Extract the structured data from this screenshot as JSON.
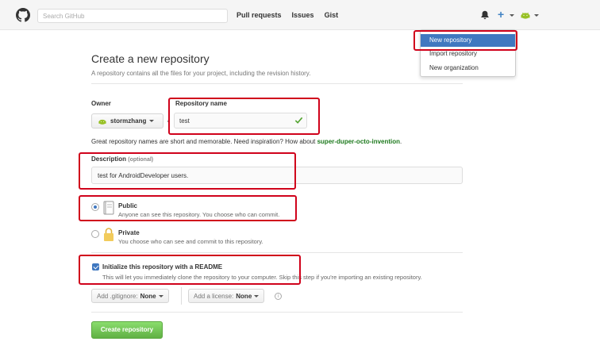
{
  "header": {
    "search_placeholder": "Search GitHub",
    "nav": [
      "Pull requests",
      "Issues",
      "Gist"
    ]
  },
  "dropdown": {
    "items": [
      "New repository",
      "Import repository",
      "New organization"
    ]
  },
  "page": {
    "title": "Create a new repository",
    "subtitle": "A repository contains all the files for your project, including the revision history."
  },
  "owner": {
    "label": "Owner",
    "value": "stormzhang"
  },
  "repo": {
    "label": "Repository name",
    "separator": "/",
    "value": "test"
  },
  "hint": {
    "text": "Great repository names are short and memorable. Need inspiration? How about ",
    "suggestion": "super-duper-octo-invention",
    "end": "."
  },
  "description": {
    "label": "Description",
    "optional": "(optional)",
    "value": "test for AndroidDeveloper users."
  },
  "visibility": {
    "public_title": "Public",
    "public_desc": "Anyone can see this repository. You choose who can commit.",
    "private_title": "Private",
    "private_desc": "You choose who can see and commit to this repository."
  },
  "readme": {
    "title": "Initialize this repository with a README",
    "desc": "This will let you immediately clone the repository to your computer. Skip this step if you're importing an existing repository."
  },
  "gitignore": {
    "prefix": "Add .gitignore:",
    "value": "None"
  },
  "license": {
    "prefix": "Add a license:",
    "value": "None"
  },
  "info_glyph": "i",
  "create_button": "Create repository",
  "colors": {
    "accent": "#4078c0",
    "highlight": "#d0021b",
    "primary_button": "#60b044",
    "suggestion": "#1e7a1e"
  }
}
